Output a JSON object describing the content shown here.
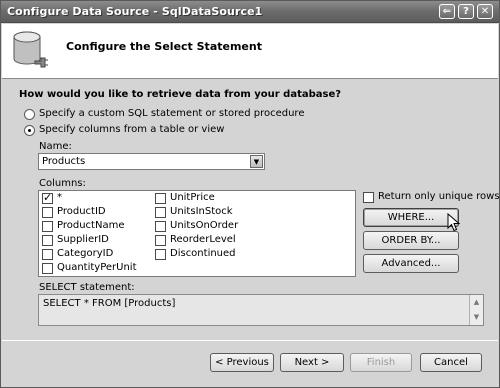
{
  "window": {
    "title": "Configure Data Source - SqlDataSource1",
    "buttons": {
      "back": "⇐",
      "help": "?",
      "close": "✕"
    }
  },
  "header": {
    "heading": "Configure the Select Statement",
    "icon": "database-icon"
  },
  "question": "How would you like to retrieve data from your database?",
  "options": {
    "custom": "Specify a custom SQL statement or stored procedure",
    "columns": "Specify columns from a table or view",
    "selected": "columns"
  },
  "name_section": {
    "label": "Name:",
    "value": "Products"
  },
  "columns_section": {
    "label": "Columns:",
    "left": [
      {
        "name": "*",
        "checked": true
      },
      {
        "name": "ProductID",
        "checked": false
      },
      {
        "name": "ProductName",
        "checked": false
      },
      {
        "name": "SupplierID",
        "checked": false
      },
      {
        "name": "CategoryID",
        "checked": false
      },
      {
        "name": "QuantityPerUnit",
        "checked": false
      }
    ],
    "right": [
      {
        "name": "UnitPrice",
        "checked": false
      },
      {
        "name": "UnitsInStock",
        "checked": false
      },
      {
        "name": "UnitsOnOrder",
        "checked": false
      },
      {
        "name": "ReorderLevel",
        "checked": false
      },
      {
        "name": "Discontinued",
        "checked": false
      }
    ]
  },
  "side": {
    "unique_rows": "Return only unique rows",
    "where": "WHERE...",
    "order_by": "ORDER BY...",
    "advanced": "Advanced..."
  },
  "statement": {
    "label": "SELECT statement:",
    "value": "SELECT * FROM [Products]"
  },
  "footer": {
    "previous": "< Previous",
    "next": "Next >",
    "finish": "Finish",
    "cancel": "Cancel"
  }
}
